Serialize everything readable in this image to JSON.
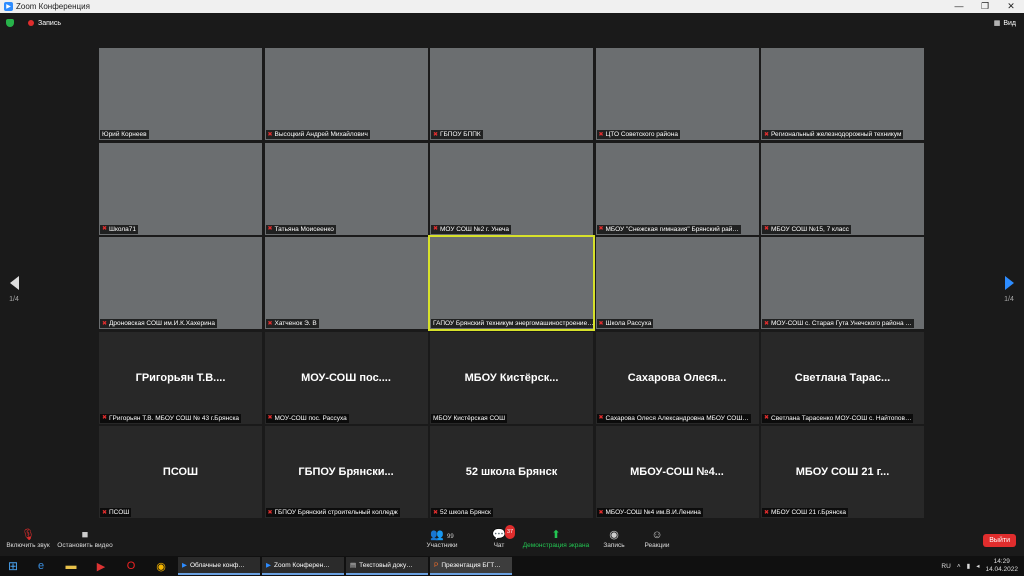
{
  "window": {
    "title": "Zoom Конференция",
    "controls": [
      "—",
      "❐",
      "✕"
    ]
  },
  "topbar": {
    "recording_label": "Запись",
    "view_label": "Вид"
  },
  "pagination": {
    "left": "1/4",
    "right": "1/4"
  },
  "tiles": [
    {
      "label": "Юрий Корнеев",
      "video": true,
      "muted": false
    },
    {
      "label": "Высоцкий Андрей Михайлович",
      "video": true,
      "muted": true
    },
    {
      "label": "ГБПОУ БППК",
      "video": true,
      "muted": true
    },
    {
      "label": "ЦТО Советского района",
      "video": true,
      "muted": true
    },
    {
      "label": "Региональный железнодорожный техникум",
      "video": true,
      "muted": true
    },
    {
      "label": "Школа71",
      "video": true,
      "muted": true
    },
    {
      "label": "Татьяна Моисеенко",
      "video": true,
      "muted": true
    },
    {
      "label": "МОУ СОШ №2 г. Унеча",
      "video": true,
      "muted": true
    },
    {
      "label": "МБОУ \"Снежская гимназия\" Брянский рай…",
      "video": true,
      "muted": true
    },
    {
      "label": "МБОУ СОШ №15, 7 класс",
      "video": true,
      "muted": true
    },
    {
      "label": "Дроновская СОШ им.И.К.Хахерина",
      "video": true,
      "muted": true
    },
    {
      "label": "Хатченок Э. В",
      "video": true,
      "muted": true
    },
    {
      "label": "ГАПОУ Брянский техникум энергомашиностроение…",
      "video": true,
      "muted": false,
      "active": true
    },
    {
      "label": "Школа Рассуха",
      "video": true,
      "muted": true
    },
    {
      "label": "МОУ-СОШ с. Старая Гута Унечского района …",
      "video": true,
      "muted": true
    },
    {
      "name": "ГРигорьян Т.В....",
      "label": "ГРигорьян Т.В. МБОУ СОШ № 43 г.Брянска",
      "video": false,
      "muted": true
    },
    {
      "name": "МОУ-СОШ пос....",
      "label": "МОУ-СОШ пос. Рассуха",
      "video": false,
      "muted": true
    },
    {
      "name": "МБОУ Кистёрск...",
      "label": "МБОУ Кистёрская СОШ",
      "video": false,
      "muted": false
    },
    {
      "name": "Сахарова Олеся...",
      "label": "Сахарова Олеся Александровна МБОУ СОШ…",
      "video": false,
      "muted": true
    },
    {
      "name": "Светлана Тарас...",
      "label": "Светлана Тарасенко МОУ-СОШ с. Найтопов…",
      "video": false,
      "muted": true
    },
    {
      "name": "ПСОШ",
      "label": "ПСОШ",
      "video": false,
      "muted": true
    },
    {
      "name": "ГБПОУ Брянски...",
      "label": "ГБПОУ Брянский строительный колледж",
      "video": false,
      "muted": true
    },
    {
      "name": "52 школа Брянск",
      "label": "52 школа Брянск",
      "video": false,
      "muted": true
    },
    {
      "name": "МБОУ-СОШ №4...",
      "label": "МБОУ-СОШ №4 им.В.И.Ленина",
      "video": false,
      "muted": true
    },
    {
      "name": "МБОУ СОШ 21 г...",
      "label": "МБОУ СОШ 21 г.Брянска",
      "video": false,
      "muted": true
    }
  ],
  "toolbar": {
    "unmute": "Включить звук",
    "video": "Остановить видео",
    "participants": "Участники",
    "participants_count": "99",
    "chat": "Чат",
    "chat_badge": "37",
    "share": "Демонстрация экрана",
    "record": "Запись",
    "reactions": "Реакции",
    "leave": "Выйти",
    "share_color": "#23c552"
  },
  "taskbar": {
    "apps": [
      "Облачные конф…",
      "Zoom Конферен…",
      "Текстовый доку…",
      "Презентация БГТ…"
    ],
    "lang": "RU",
    "time": "14:29",
    "date": "14.04.2022"
  }
}
